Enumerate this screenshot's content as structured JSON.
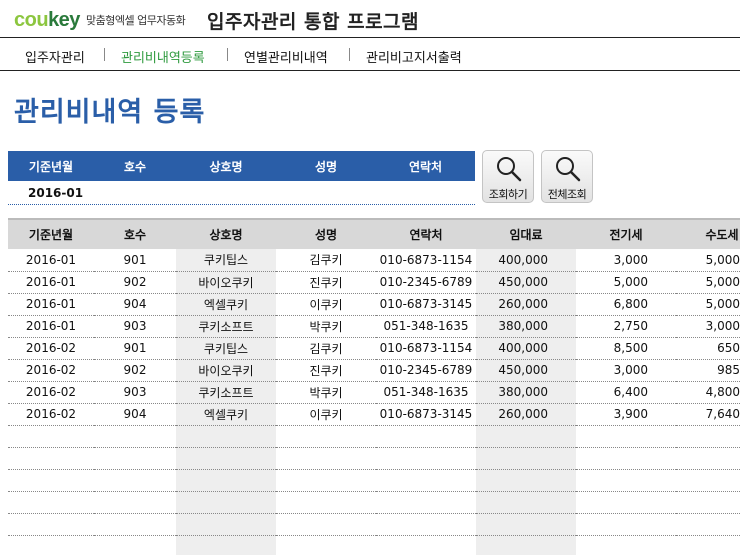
{
  "brand": {
    "logo_a": "cou",
    "logo_b": "key",
    "tagline": "맞춤형엑셀 업무자동화"
  },
  "app_title": "입주자관리 통합 프로그램",
  "nav": [
    {
      "label": "입주자관리",
      "active": false
    },
    {
      "label": "관리비내역등록",
      "active": true
    },
    {
      "label": "연별관리비내역",
      "active": false
    },
    {
      "label": "관리비고지서출력",
      "active": false
    }
  ],
  "page_title": "관리비내역 등록",
  "search": {
    "headers": [
      "기준년월",
      "호수",
      "상호명",
      "성명",
      "연락처"
    ],
    "value": "2016-01"
  },
  "buttons": {
    "query": "조회하기",
    "query_all": "전체조회"
  },
  "table": {
    "columns": [
      "기준년월",
      "호수",
      "상호명",
      "성명",
      "연락처",
      "임대료",
      "전기세",
      "수도세"
    ],
    "rows": [
      [
        "2016-01",
        "901",
        "쿠키팁스",
        "김쿠키",
        "010-6873-1154",
        "400,000",
        "3,000",
        "5,000"
      ],
      [
        "2016-01",
        "902",
        "바이오쿠키",
        "진쿠키",
        "010-2345-6789",
        "450,000",
        "5,000",
        "5,000"
      ],
      [
        "2016-01",
        "904",
        "엑셀쿠키",
        "이쿠키",
        "010-6873-3145",
        "260,000",
        "6,800",
        "5,000"
      ],
      [
        "2016-01",
        "903",
        "쿠키소프트",
        "박쿠키",
        "051-348-1635",
        "380,000",
        "2,750",
        "3,000"
      ],
      [
        "2016-02",
        "901",
        "쿠키팁스",
        "김쿠키",
        "010-6873-1154",
        "400,000",
        "8,500",
        "650"
      ],
      [
        "2016-02",
        "902",
        "바이오쿠키",
        "진쿠키",
        "010-2345-6789",
        "450,000",
        "3,000",
        "985"
      ],
      [
        "2016-02",
        "903",
        "쿠키소프트",
        "박쿠키",
        "051-348-1635",
        "380,000",
        "6,400",
        "4,800"
      ],
      [
        "2016-02",
        "904",
        "엑셀쿠키",
        "이쿠키",
        "010-6873-3145",
        "260,000",
        "3,900",
        "7,640"
      ]
    ],
    "blank_rows": 6
  },
  "colors": {
    "accent": "#2a5ea8",
    "nav_active": "#2e9a3e",
    "logo_light": "#8cc63f",
    "logo_dark": "#2a7a3b"
  }
}
